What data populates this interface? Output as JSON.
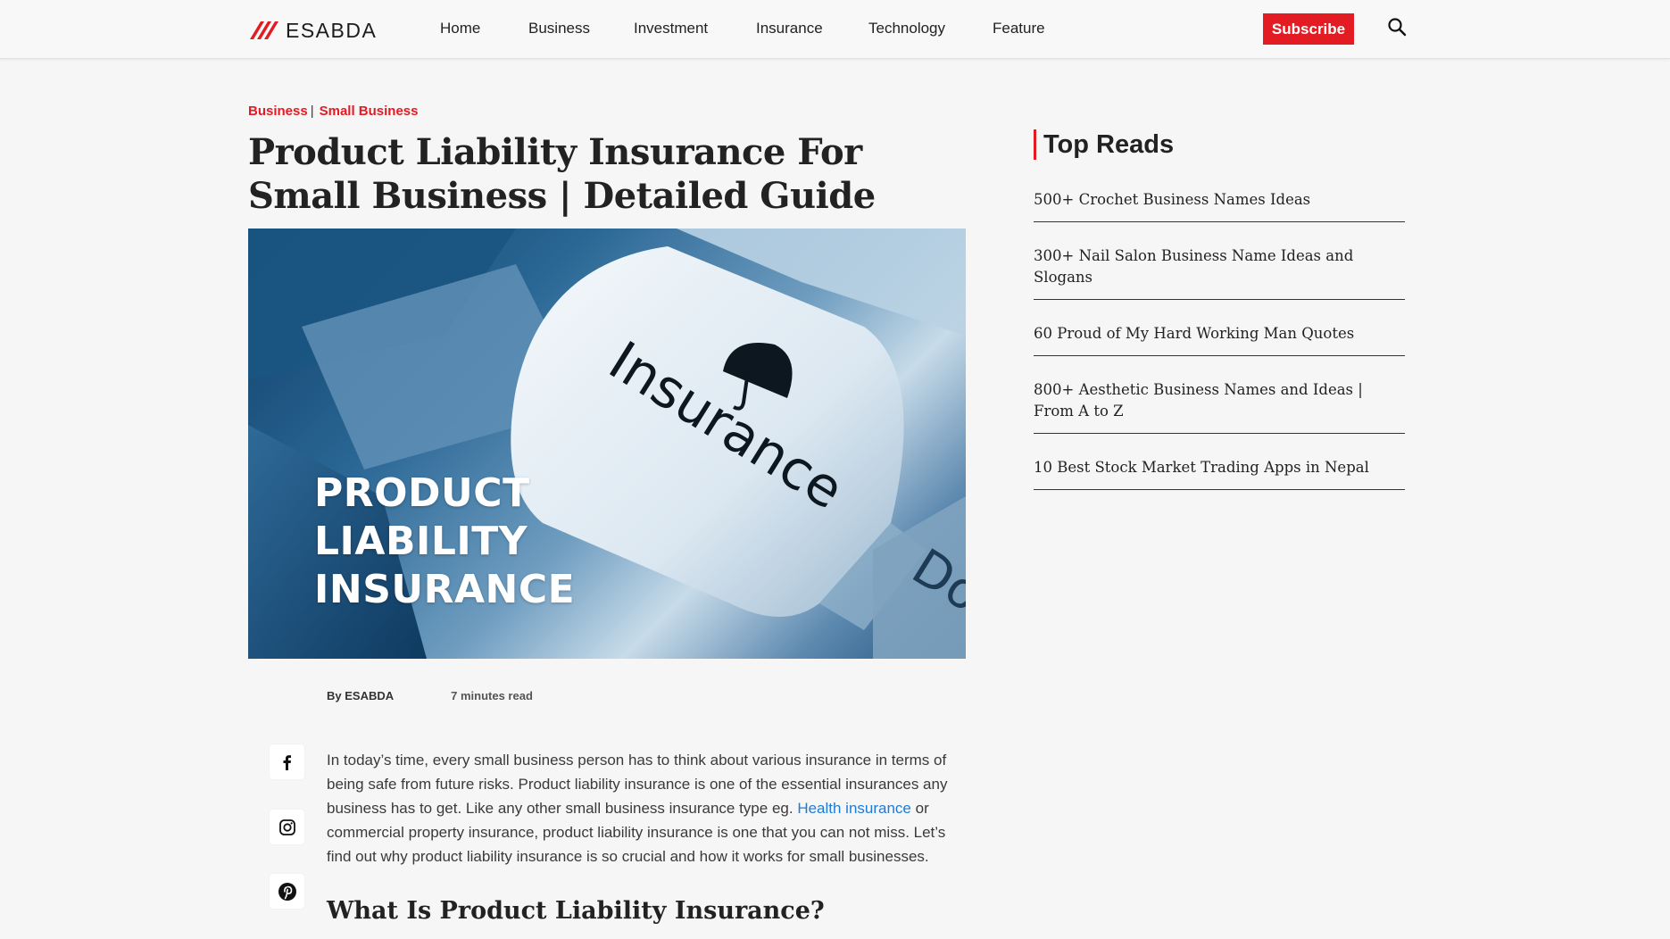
{
  "brand": {
    "name": "ESABDA",
    "accent": "#e31b23"
  },
  "nav": {
    "items": [
      "Home",
      "Business",
      "Investment",
      "Insurance",
      "Technology",
      "Feature"
    ],
    "subscribe_label": "Subscribe",
    "search_icon": "search-icon"
  },
  "article": {
    "breadcrumb": [
      "Business",
      "Small Business"
    ],
    "breadcrumb_separator": "|",
    "title": "Product Liability Insurance For Small Business | Detailed Guide",
    "hero": {
      "key_label": "Insurance",
      "key_label_2": "Do",
      "overlay_lines": [
        "PRODUCT",
        "LIABILITY",
        "INSURANCE"
      ]
    },
    "author": "By ESABDA",
    "reading_time": "7 minutes read",
    "share_icons": [
      "facebook-icon",
      "instagram-icon",
      "pinterest-icon"
    ],
    "intro_before_link": "In today’s time, every small business person has to think about various insurance in terms of being safe from future risks. Product liability insurance is one of the essential insurances any business has to get. Like any other small business insurance type eg. ",
    "intro_link": "Health insurance",
    "intro_after_link": " or commercial property insurance, product liability insurance is one that you can not miss. Let’s find out why product liability insurance is so crucial and how it works for small businesses.",
    "section_heading": "What Is Product Liability Insurance?"
  },
  "sidebar": {
    "title": "Top Reads",
    "items": [
      "500+ Crochet Business Names Ideas",
      "300+ Nail Salon Business Name Ideas and Slogans",
      "60 Proud of My Hard Working Man Quotes",
      "800+ Aesthetic Business Names and Ideas | From A to Z",
      "10 Best Stock Market Trading Apps in Nepal"
    ]
  }
}
